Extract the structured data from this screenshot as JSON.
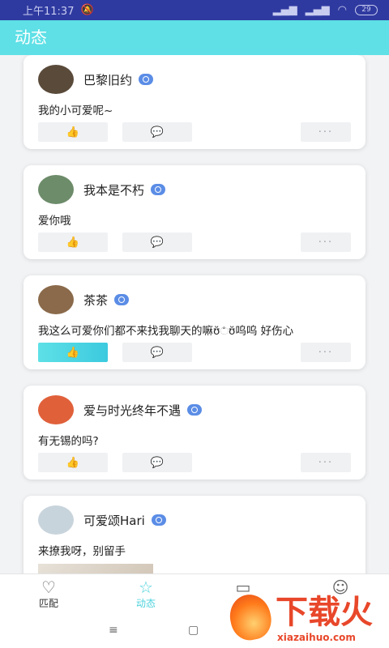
{
  "status_bar": {
    "time": "上午11:37",
    "battery": "29"
  },
  "header": {
    "title": "动态"
  },
  "posts": [
    {
      "author": "巴黎旧约",
      "text": "我的小可爱呢~",
      "liked": false,
      "avatar_color": "#5a4a3a"
    },
    {
      "author": "我本是不朽",
      "text": "爱你哦",
      "liked": false,
      "avatar_color": "#6d8c6a"
    },
    {
      "author": "茶茶",
      "text": "我这么可爱你们都不来找我聊天的嘛ʊ̆ಁʊ̆呜呜 好伤心",
      "liked": true,
      "avatar_color": "#8a6a4a"
    },
    {
      "author": "爱与时光终年不遇",
      "text": "有无锡的吗?",
      "liked": false,
      "avatar_color": "#e0603a"
    },
    {
      "author": "可爱颂Hari",
      "text": "来撩我呀，别留手",
      "liked": false,
      "avatar_color": "#c8d4dc"
    }
  ],
  "actions": {
    "like_icon": "thumbs-up-icon",
    "comment_icon": "comment-icon",
    "more_label": "···"
  },
  "bottom_nav": [
    {
      "label": "匹配",
      "icon": "heart-icon",
      "active": false
    },
    {
      "label": "动态",
      "icon": "star-icon",
      "active": true
    },
    {
      "label": "",
      "icon": "message-icon",
      "active": false
    },
    {
      "label": "",
      "icon": "smile-icon",
      "active": false
    }
  ],
  "watermark": {
    "title": "下载火",
    "url": "xiazaihuo.com"
  },
  "colors": {
    "accent": "#5ee0e6",
    "status_bar": "#2f3aa0",
    "badge": "#5b8de6",
    "watermark": "#e8472a"
  }
}
